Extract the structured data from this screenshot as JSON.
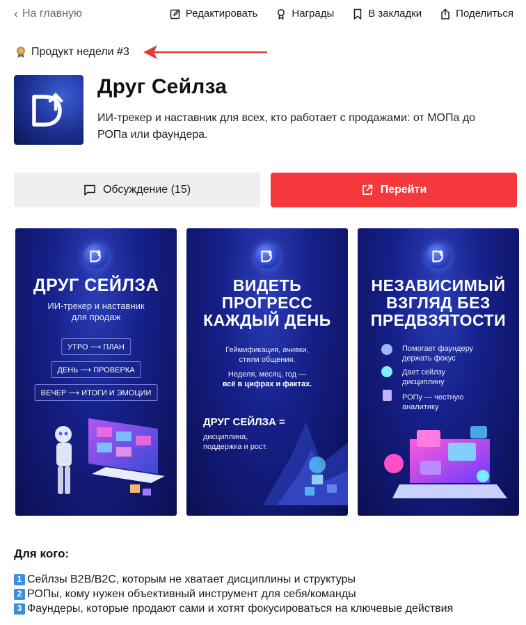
{
  "nav": {
    "back_label": "На главную",
    "actions": [
      {
        "label": "Редактировать",
        "icon": "edit-icon"
      },
      {
        "label": "Награды",
        "icon": "award-icon"
      },
      {
        "label": "В закладки",
        "icon": "bookmark-icon"
      },
      {
        "label": "Поделиться",
        "icon": "share-icon"
      }
    ]
  },
  "badge": {
    "label": "Продукт недели #3",
    "icon": "medal-icon"
  },
  "product": {
    "title": "Друг Сейлза",
    "description": "ИИ-трекер и наставник для всех, кто работает с продажами: от МОПа до РОПа или фаундера."
  },
  "buttons": {
    "discuss_label": "Обсуждение (15)",
    "go_label": "Перейти"
  },
  "gallery": {
    "card1": {
      "title": "ДРУГ СЕЙЛЗА",
      "subtitle_1": "ИИ-трекер и наставник",
      "subtitle_2": "для продаж",
      "pills": [
        "УТРО ⟶ ПЛАН",
        "ДЕНЬ ⟶ ПРОВЕРКА",
        "ВЕЧЕР ⟶ ИТОГИ И ЭМОЦИИ"
      ]
    },
    "card2": {
      "title_1": "ВИДЕТЬ",
      "title_2": "ПРОГРЕСС",
      "title_3": "КАЖДЫЙ ДЕНЬ",
      "text_1": "Геймификация, ачивки,",
      "text_2": "стили общения.",
      "text_3": "Неделя, месяц, год —",
      "text_4": "всё в цифрах и фактах.",
      "footer_title": "ДРУГ СЕЙЛЗА =",
      "footer_1": "дисциплина,",
      "footer_2": "поддержка и рост."
    },
    "card3": {
      "title_1": "НЕЗАВИСИМЫЙ",
      "title_2": "ВЗГЛЯД БЕЗ",
      "title_3": "ПРЕДВЗЯТОСТИ",
      "items": [
        {
          "line_1": "Помогает фаундеру",
          "line_2": "держать фокус"
        },
        {
          "line_1": "Дает сейлзу",
          "line_2": "дисциплину"
        },
        {
          "line_1": "РОПу — честную",
          "line_2": "аналитику"
        }
      ]
    }
  },
  "for_who": {
    "heading": "Для кого:",
    "items": [
      {
        "num": "1",
        "text": "Сейлзы B2B/B2C, которым не хватает дисциплины и структуры"
      },
      {
        "num": "2",
        "text": "РОПы, кому нужен объективный инструмент для себя/команды"
      },
      {
        "num": "3",
        "text": "Фаундеры, которые продают сами и хотят фокусироваться на ключевые действия"
      }
    ]
  },
  "colors": {
    "go_button": "#f4383d",
    "discuss_button": "#efeff1",
    "arrow": "#e03a35",
    "card_bg": "#16208a",
    "number_badge": "#3b8ee0"
  }
}
